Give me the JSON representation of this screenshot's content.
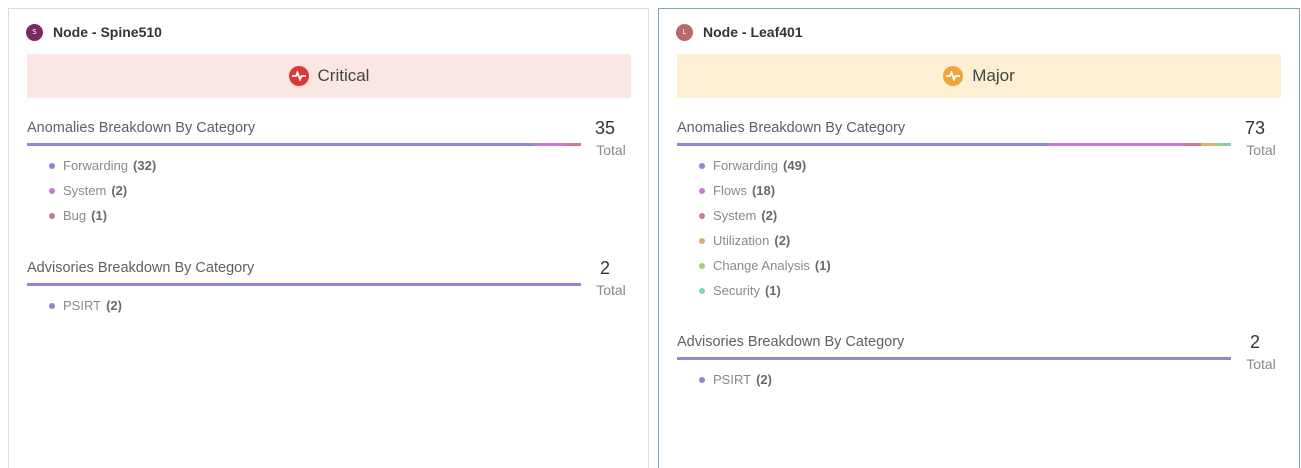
{
  "cards": [
    {
      "node_label": "Node - ",
      "node_name": "Spine510",
      "avatar_letter": "S",
      "avatar_color": "#7a2a63",
      "severity": {
        "label": "Critical",
        "bg": "#fae6e3",
        "icon_color": "#d93a33",
        "icon": "pulse-icon"
      },
      "anomalies": {
        "title": "Anomalies Breakdown By Category",
        "total": "35",
        "total_label": "Total",
        "items": [
          {
            "label": "Forwarding",
            "count": "(32)",
            "value": 32,
            "color": "#8a89d2"
          },
          {
            "label": "System",
            "count": "(2)",
            "value": 2,
            "color": "#c87bd2"
          },
          {
            "label": "Bug",
            "count": "(1)",
            "value": 1,
            "color": "#c97a94"
          }
        ]
      },
      "advisories": {
        "title": "Advisories Breakdown By Category",
        "total": "2",
        "total_label": "Total",
        "items": [
          {
            "label": "PSIRT",
            "count": "(2)",
            "value": 2,
            "color": "#8a89d2"
          }
        ]
      }
    },
    {
      "node_label": "Node - ",
      "node_name": "Leaf401",
      "avatar_letter": "L",
      "avatar_color": "#b46b6b",
      "severity": {
        "label": "Major",
        "bg": "#fcefd3",
        "icon_color": "#f0a43a",
        "icon": "pulse-icon"
      },
      "anomalies": {
        "title": "Anomalies Breakdown By Category",
        "total": "73",
        "total_label": "Total",
        "items": [
          {
            "label": "Forwarding",
            "count": "(49)",
            "value": 49,
            "color": "#8a89d2"
          },
          {
            "label": "Flows",
            "count": "(18)",
            "value": 18,
            "color": "#c87bd2"
          },
          {
            "label": "System",
            "count": "(2)",
            "value": 2,
            "color": "#c97a94"
          },
          {
            "label": "Utilization",
            "count": "(2)",
            "value": 2,
            "color": "#d8b07a"
          },
          {
            "label": "Change Analysis",
            "count": "(1)",
            "value": 1,
            "color": "#9fcf7e"
          },
          {
            "label": "Security",
            "count": "(1)",
            "value": 1,
            "color": "#7fd3b0"
          }
        ]
      },
      "advisories": {
        "title": "Advisories Breakdown By Category",
        "total": "2",
        "total_label": "Total",
        "items": [
          {
            "label": "PSIRT",
            "count": "(2)",
            "value": 2,
            "color": "#8a89d2"
          }
        ]
      }
    }
  ]
}
